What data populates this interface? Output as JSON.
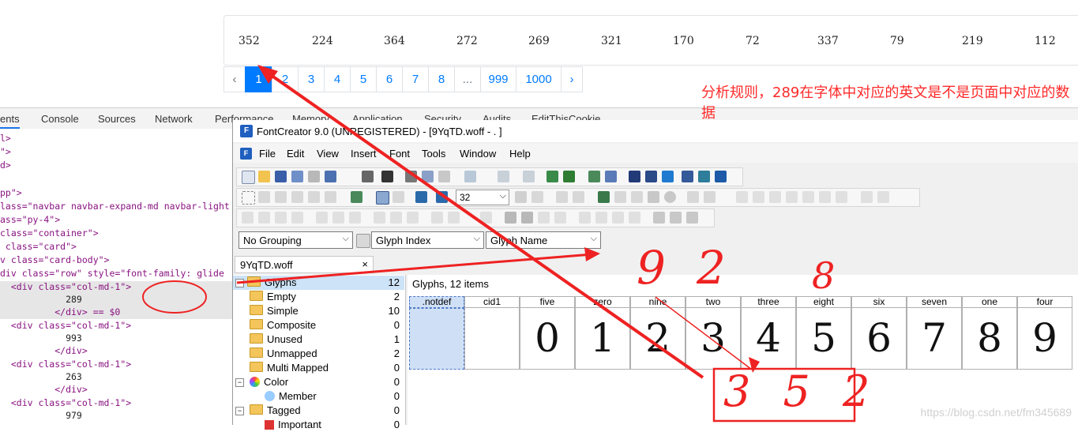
{
  "web": {
    "numbers": [
      "352",
      "224",
      "364",
      "272",
      "269",
      "321",
      "170",
      "72",
      "337",
      "79",
      "219",
      "112"
    ],
    "pagination": [
      "‹",
      "1",
      "2",
      "3",
      "4",
      "5",
      "6",
      "7",
      "8",
      "...",
      "999",
      "1000",
      "›"
    ],
    "active_page": "1"
  },
  "annotation_text": "分析规则，289在字体中对应的英文是不是页面中对应的数据",
  "devtools": {
    "tabs": [
      "ents",
      "Console",
      "Sources",
      "Network",
      "Performance",
      "Memory",
      "Application",
      "Security",
      "Audits",
      "EditThisCookie"
    ],
    "lines": [
      {
        "t": "l>"
      },
      {
        "t": "\">"
      },
      {
        "t": "d>"
      },
      {
        "t": ""
      },
      {
        "t": "pp\">"
      },
      {
        "t": "lass=\"navbar navbar-expand-md navbar-light"
      },
      {
        "t": "ass=\"py-4\">"
      },
      {
        "t": "class=\"container\">"
      },
      {
        "t": " class=\"card\">"
      },
      {
        "t": "v class=\"card-body\">"
      },
      {
        "t": "div class=\"row\" style=\"font-family: glide"
      },
      {
        "t": "  <div class=\"col-md-1\">"
      },
      {
        "t": "            289"
      },
      {
        "t": "          </div> == $0"
      },
      {
        "t": "  <div class=\"col-md-1\">"
      },
      {
        "t": "            993"
      },
      {
        "t": "          </div>"
      },
      {
        "t": "  <div class=\"col-md-1\">"
      },
      {
        "t": "            263"
      },
      {
        "t": "          </div>"
      },
      {
        "t": "  <div class=\"col-md-1\">"
      },
      {
        "t": "            979"
      }
    ]
  },
  "fontcreator": {
    "title": "FontCreator 9.0 (UNREGISTERED) - [9YqTD.woff - . ]",
    "menu": [
      "File",
      "Edit",
      "View",
      "Insert",
      "Font",
      "Tools",
      "Window",
      "Help"
    ],
    "zoom": "32",
    "grouping": "No Grouping",
    "index": "Glyph Index",
    "name_sel": "Glyph Name",
    "file_tab": "9YqTD.woff",
    "tree": [
      {
        "label": "Glyphs",
        "count": "12"
      },
      {
        "label": "Empty",
        "count": "2"
      },
      {
        "label": "Simple",
        "count": "10"
      },
      {
        "label": "Composite",
        "count": "0"
      },
      {
        "label": "Unused",
        "count": "1"
      },
      {
        "label": "Unmapped",
        "count": "2"
      },
      {
        "label": "Multi Mapped",
        "count": "0"
      },
      {
        "label": "Color",
        "count": "0"
      },
      {
        "label": "Member",
        "count": "0"
      },
      {
        "label": "Tagged",
        "count": "0"
      },
      {
        "label": "Important",
        "count": "0"
      }
    ],
    "glyphs_header": "Glyphs, 12 items",
    "glyphs": [
      {
        "name": ".notdef",
        "char": ""
      },
      {
        "name": "cid1",
        "char": ""
      },
      {
        "name": "five",
        "char": "0"
      },
      {
        "name": "zero",
        "char": "1"
      },
      {
        "name": "nine",
        "char": "2"
      },
      {
        "name": "two",
        "char": "3"
      },
      {
        "name": "three",
        "char": "4"
      },
      {
        "name": "eight",
        "char": "5"
      },
      {
        "name": "six",
        "char": "6"
      },
      {
        "name": "seven",
        "char": "7"
      },
      {
        "name": "one",
        "char": "8"
      },
      {
        "name": "four",
        "char": "9"
      }
    ]
  },
  "scribbles": {
    "over_nine": "9",
    "over_two": "2",
    "over_eight": "8",
    "box": "3 5 2"
  },
  "watermark": "https://blog.csdn.net/fm345689"
}
